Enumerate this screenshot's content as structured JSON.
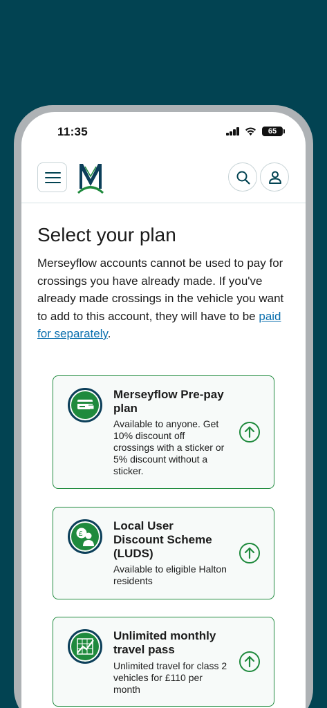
{
  "status_bar": {
    "time": "11:35",
    "battery": "65"
  },
  "header": {
    "menu_icon": "hamburger-icon",
    "logo_icon": "merseyflow-logo",
    "search_icon": "search-icon",
    "account_icon": "user-icon"
  },
  "page": {
    "title": "Select your plan",
    "intro_text": "Merseyflow accounts cannot be used to pay for crossings you have already made. If you've already made crossings in the vehicle you want to add to this account, they will have to be ",
    "intro_link": "paid for separately",
    "intro_end": "."
  },
  "plans": [
    {
      "title": "Merseyflow Pre-pay plan",
      "description": "Available to anyone. Get 10% discount off crossings with a sticker or 5% discount without a sticker.",
      "icon": "card-payment-icon",
      "action_icon": "arrow-up-circle-icon"
    },
    {
      "title": "Local User Discount Scheme (LUDS)",
      "description": "Available to eligible Halton residents",
      "icon": "local-user-icon",
      "action_icon": "arrow-up-circle-icon"
    },
    {
      "title": "Unlimited monthly travel pass",
      "description": "Unlimited travel for class 2 vehicles for £110 per month",
      "icon": "calendar-trend-icon",
      "action_icon": "arrow-up-circle-icon"
    }
  ],
  "colors": {
    "background": "#024352",
    "accent_green": "#1f8a3d",
    "link_blue": "#0a6fae",
    "brand_navy": "#0c3f5a"
  }
}
